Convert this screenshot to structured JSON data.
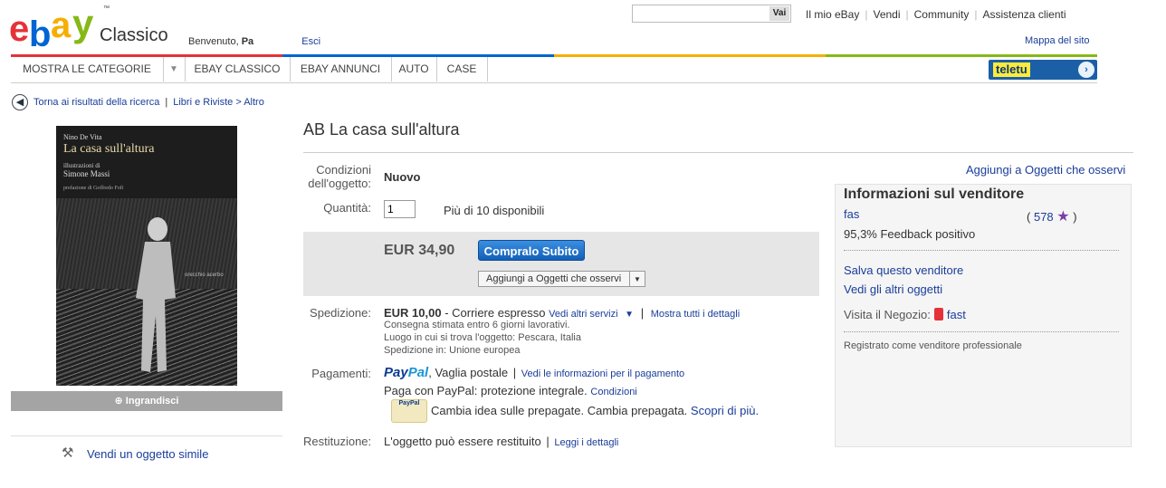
{
  "header": {
    "logo_letters": [
      "e",
      "b",
      "a",
      "y"
    ],
    "logo_tm": "™",
    "logo_suffix": "Classico",
    "welcome_prefix": "Benvenuto,",
    "welcome_name": "Pa",
    "logout": "Esci",
    "search_value": "",
    "search_button": "Vai",
    "links": [
      "Il mio eBay",
      "Vendi",
      "Community",
      "Assistenza clienti"
    ],
    "sitemap": "Mappa del sito"
  },
  "nav": {
    "categories": "MOSTRA LE CATEGORIE",
    "items": [
      "EBAY CLASSICO",
      "EBAY ANNUNCI",
      "AUTO",
      "CASE"
    ],
    "banner": "teletu"
  },
  "breadcrumb": {
    "back": "Torna ai risultati della ricerca",
    "path": "Libri e Riviste > Altro"
  },
  "book_cover": {
    "author": "Nino De Vita",
    "title": "La casa sull'altura",
    "illustrations_label": "illustrazioni di",
    "illustrator": "Simone Massi",
    "preface": "prefazione di Goffredo Fofi",
    "publisher": "orecchio acerbo"
  },
  "left": {
    "enlarge": "Ingrandisci",
    "sell_similar": "Vendi un oggetto simile"
  },
  "item": {
    "title": "AB La casa sull'altura",
    "condition_label": "Condizioni dell'oggetto:",
    "condition_value": "Nuovo",
    "quantity_label": "Quantità:",
    "quantity_value": "1",
    "quantity_available": "Più di 10 disponibili",
    "price": "EUR 34,90",
    "buy_now": "Compralo Subito",
    "watch": "Aggiungi a Oggetti che osservi",
    "watch_top": "Aggiungi a Oggetti che osservi"
  },
  "shipping": {
    "label": "Spedizione:",
    "cost": "EUR 10,00",
    "method": "- Corriere espresso",
    "other_services": "Vedi altri servizi",
    "show_details": "Mostra tutti i dettagli",
    "delivery": "Consegna stimata entro 6 giorni lavorativi.",
    "location": "Luogo in cui si trova l'oggetto: Pescara, Italia",
    "ships_to": "Spedizione in: Unione europea"
  },
  "payments": {
    "label": "Pagamenti:",
    "paypal_a": "Pay",
    "paypal_b": "Pal",
    "methods": ", Vaglia postale",
    "see_info": "Vedi le informazioni per il pagamento",
    "protection": "Paga con PayPal: protezione integrale.",
    "conditions": "Condizioni",
    "card_label": "PayPal",
    "prepaid": "Cambia idea sulle prepagate. Cambia prepagata.",
    "learn_more": "Scopri di più."
  },
  "returns": {
    "label": "Restituzione:",
    "value": "L'oggetto può essere restituito",
    "read_details": "Leggi i dettagli"
  },
  "seller": {
    "title": "Informazioni sul venditore",
    "name": "fas",
    "feedback_score": "578",
    "open_paren": "(",
    "close_paren": ")",
    "positive": "95,3% Feedback positivo",
    "save": "Salva questo venditore",
    "other_items": "Vedi gli altri oggetti",
    "store_label": "Visita il Negozio:",
    "store_name": "fast",
    "registered": "Registrato come venditore professionale"
  },
  "colors": {
    "link": "#1a3d9a",
    "ebay_red": "#e53238",
    "ebay_blue": "#0064d2",
    "ebay_yellow": "#f5af02",
    "ebay_green": "#86b817",
    "buy_button": "#1f6ec8"
  }
}
